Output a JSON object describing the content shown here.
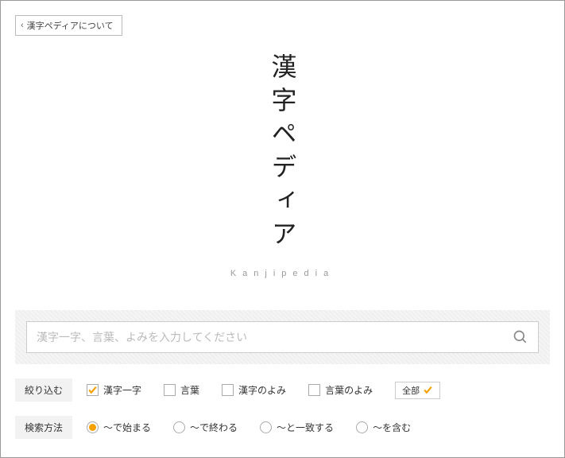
{
  "header": {
    "about_label": "漢字ペディアについて"
  },
  "logo": {
    "vertical": "漢字ペディア",
    "sub": "Kanjipedia"
  },
  "search": {
    "placeholder": "漢字一字、言葉、よみを入力してください",
    "value": ""
  },
  "filter": {
    "label": "絞り込む",
    "options": [
      {
        "label": "漢字一字",
        "checked": true
      },
      {
        "label": "言葉",
        "checked": false
      },
      {
        "label": "漢字のよみ",
        "checked": false
      },
      {
        "label": "言葉のよみ",
        "checked": false
      }
    ],
    "all_label": "全部"
  },
  "method": {
    "label": "検索方法",
    "options": [
      {
        "label": "～で始まる",
        "selected": true
      },
      {
        "label": "～で終わる",
        "selected": false
      },
      {
        "label": "～と一致する",
        "selected": false
      },
      {
        "label": "～を含む",
        "selected": false
      }
    ]
  },
  "colors": {
    "accent": "#f5a100"
  }
}
